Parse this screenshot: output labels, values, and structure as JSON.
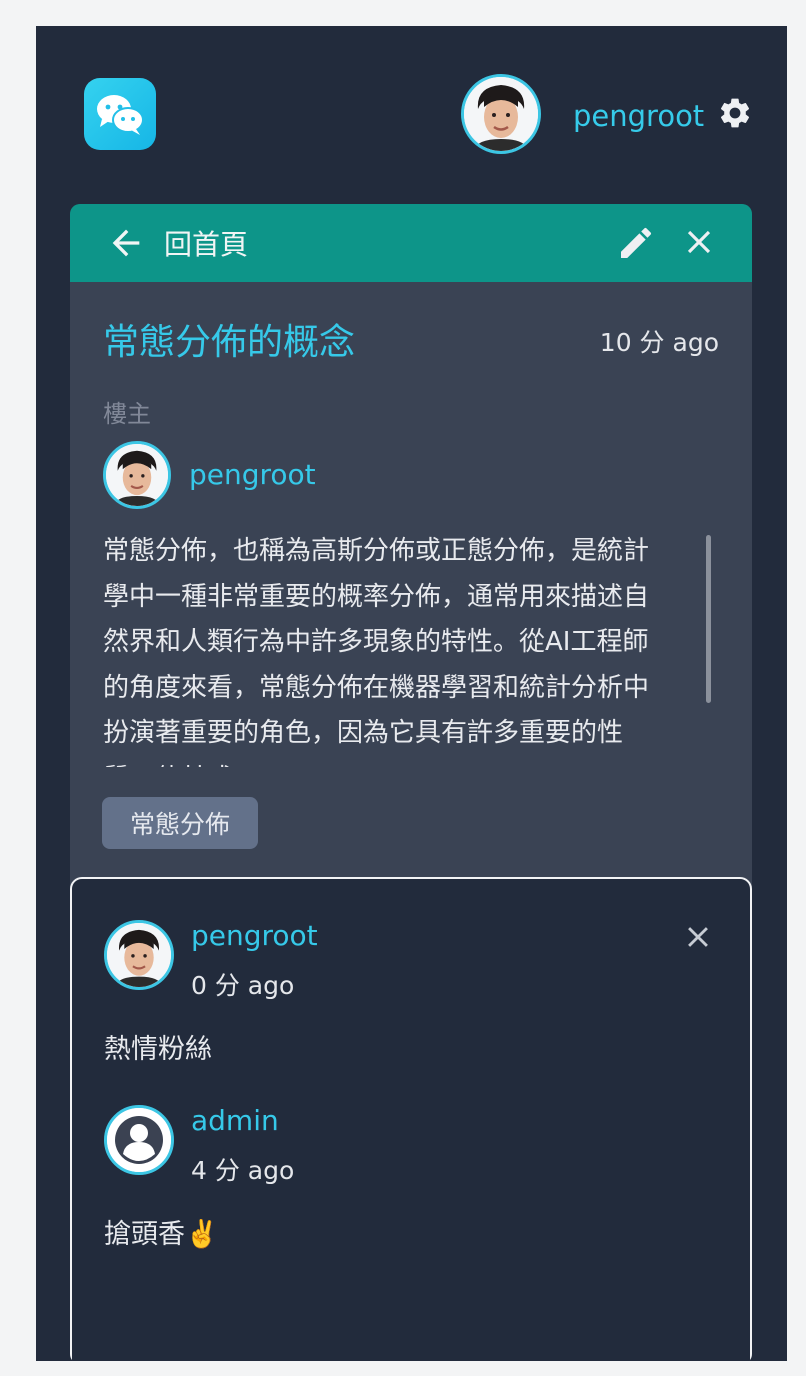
{
  "header": {
    "logo_icon": "wechat-bubbles-icon",
    "username": "pengroot",
    "settings_icon": "gear-icon"
  },
  "card": {
    "back_label": "回首頁",
    "edit_icon": "pencil-icon",
    "close_icon": "close-icon",
    "title": "常態分佈的概念",
    "time": "10 分 ago",
    "op_label": "樓主",
    "author": "pengroot",
    "body": "常態分佈，也稱為高斯分佈或正態分佈，是統計學中一種非常重要的概率分佈，通常用來描述自然界和人類行為中許多現象的特性。從AI工程師的角度來看，常態分佈在機器學習和統計分析中扮演著重要的角色，因為它具有許多重要的性質，使其成",
    "tag": "常態分佈"
  },
  "comments": [
    {
      "author": "pengroot",
      "time": "0 分 ago",
      "text": "熱情粉絲",
      "avatar": "user-photo"
    },
    {
      "author": "admin",
      "time": "4 分 ago",
      "text": "搶頭香✌️",
      "avatar": "default-user-icon"
    }
  ],
  "colors": {
    "accent": "#36c9e9",
    "header_bar": "#0d9589",
    "app_bg": "#222b3c",
    "card_bg": "#3a4354",
    "tag_bg": "#63718a"
  }
}
